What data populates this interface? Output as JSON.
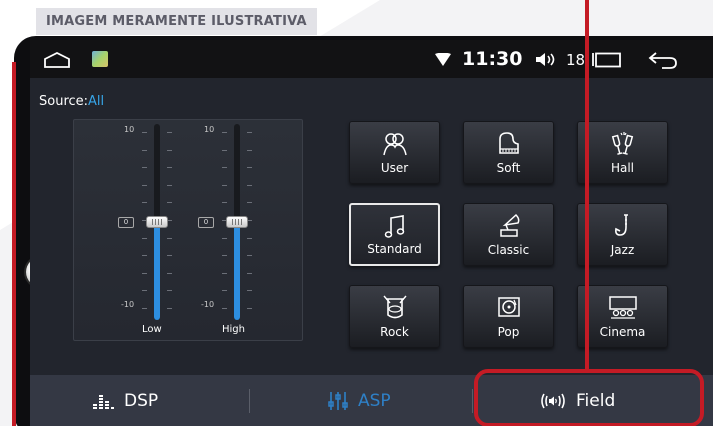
{
  "watermark": "IMAGEM MERAMENTE ILUSTRATIVA",
  "status": {
    "time": "11:30",
    "volume": "18"
  },
  "source": {
    "label": "Source:",
    "value": "All"
  },
  "equalizer": {
    "bands": [
      {
        "label": "Low",
        "value": "0",
        "max_label": "10",
        "min_label": "-10",
        "level": 0.5
      },
      {
        "label": "High",
        "value": "0",
        "max_label": "10",
        "min_label": "-10",
        "level": 0.5
      }
    ]
  },
  "presets": [
    {
      "label": "User",
      "icon": "users-icon"
    },
    {
      "label": "Soft",
      "icon": "piano-icon"
    },
    {
      "label": "Hall",
      "icon": "cheers-icon"
    },
    {
      "label": "Standard",
      "icon": "music-note-icon",
      "selected": true
    },
    {
      "label": "Classic",
      "icon": "gramophone-icon"
    },
    {
      "label": "Jazz",
      "icon": "saxophone-icon"
    },
    {
      "label": "Rock",
      "icon": "drum-icon"
    },
    {
      "label": "Pop",
      "icon": "record-icon"
    },
    {
      "label": "Cinema",
      "icon": "cinema-icon"
    }
  ],
  "tabs": {
    "dsp": "DSP",
    "asp": "ASP",
    "field": "Field"
  },
  "colors": {
    "accent": "#2E80C7",
    "highlight": "#C41B25",
    "active_text": "#37A5E8"
  }
}
